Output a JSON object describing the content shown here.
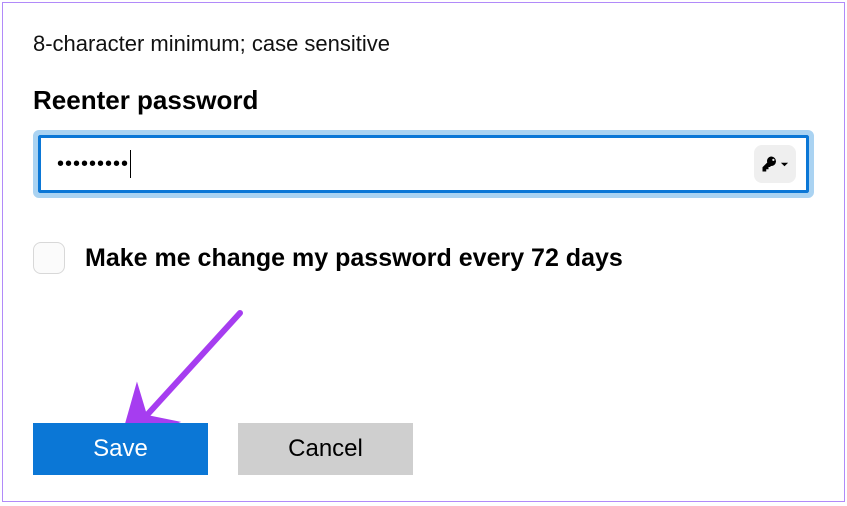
{
  "password_section": {
    "hint": "8-character minimum; case sensitive",
    "reenter_label": "Reenter password",
    "reenter_value_masked": "•••••••••",
    "password_manager_icon": "key-icon"
  },
  "options": {
    "change_every_label": "Make me change my password every 72 days",
    "change_every_checked": false
  },
  "actions": {
    "save_label": "Save",
    "cancel_label": "Cancel"
  },
  "annotation": {
    "arrow_target": "save-button",
    "arrow_color": "#a63df0"
  },
  "colors": {
    "accent": "#0b77d6",
    "focus_glow": "#aad3f2",
    "secondary_btn": "#cfcfcf",
    "panel_border": "#b18af9"
  }
}
